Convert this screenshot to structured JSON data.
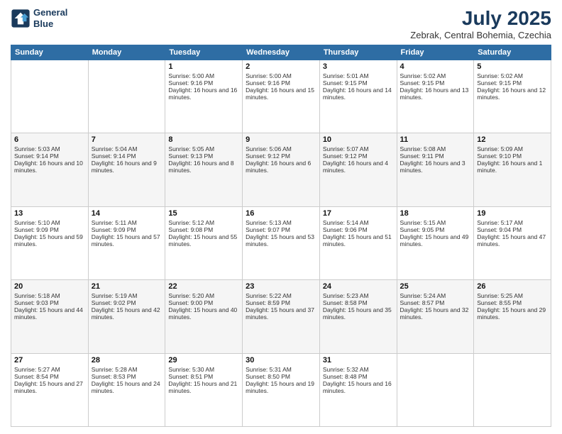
{
  "header": {
    "logo_line1": "General",
    "logo_line2": "Blue",
    "month": "July 2025",
    "location": "Zebrak, Central Bohemia, Czechia"
  },
  "days_of_week": [
    "Sunday",
    "Monday",
    "Tuesday",
    "Wednesday",
    "Thursday",
    "Friday",
    "Saturday"
  ],
  "weeks": [
    [
      {
        "day": "",
        "sunrise": "",
        "sunset": "",
        "daylight": ""
      },
      {
        "day": "",
        "sunrise": "",
        "sunset": "",
        "daylight": ""
      },
      {
        "day": "1",
        "sunrise": "Sunrise: 5:00 AM",
        "sunset": "Sunset: 9:16 PM",
        "daylight": "Daylight: 16 hours and 16 minutes."
      },
      {
        "day": "2",
        "sunrise": "Sunrise: 5:00 AM",
        "sunset": "Sunset: 9:16 PM",
        "daylight": "Daylight: 16 hours and 15 minutes."
      },
      {
        "day": "3",
        "sunrise": "Sunrise: 5:01 AM",
        "sunset": "Sunset: 9:15 PM",
        "daylight": "Daylight: 16 hours and 14 minutes."
      },
      {
        "day": "4",
        "sunrise": "Sunrise: 5:02 AM",
        "sunset": "Sunset: 9:15 PM",
        "daylight": "Daylight: 16 hours and 13 minutes."
      },
      {
        "day": "5",
        "sunrise": "Sunrise: 5:02 AM",
        "sunset": "Sunset: 9:15 PM",
        "daylight": "Daylight: 16 hours and 12 minutes."
      }
    ],
    [
      {
        "day": "6",
        "sunrise": "Sunrise: 5:03 AM",
        "sunset": "Sunset: 9:14 PM",
        "daylight": "Daylight: 16 hours and 10 minutes."
      },
      {
        "day": "7",
        "sunrise": "Sunrise: 5:04 AM",
        "sunset": "Sunset: 9:14 PM",
        "daylight": "Daylight: 16 hours and 9 minutes."
      },
      {
        "day": "8",
        "sunrise": "Sunrise: 5:05 AM",
        "sunset": "Sunset: 9:13 PM",
        "daylight": "Daylight: 16 hours and 8 minutes."
      },
      {
        "day": "9",
        "sunrise": "Sunrise: 5:06 AM",
        "sunset": "Sunset: 9:12 PM",
        "daylight": "Daylight: 16 hours and 6 minutes."
      },
      {
        "day": "10",
        "sunrise": "Sunrise: 5:07 AM",
        "sunset": "Sunset: 9:12 PM",
        "daylight": "Daylight: 16 hours and 4 minutes."
      },
      {
        "day": "11",
        "sunrise": "Sunrise: 5:08 AM",
        "sunset": "Sunset: 9:11 PM",
        "daylight": "Daylight: 16 hours and 3 minutes."
      },
      {
        "day": "12",
        "sunrise": "Sunrise: 5:09 AM",
        "sunset": "Sunset: 9:10 PM",
        "daylight": "Daylight: 16 hours and 1 minute."
      }
    ],
    [
      {
        "day": "13",
        "sunrise": "Sunrise: 5:10 AM",
        "sunset": "Sunset: 9:09 PM",
        "daylight": "Daylight: 15 hours and 59 minutes."
      },
      {
        "day": "14",
        "sunrise": "Sunrise: 5:11 AM",
        "sunset": "Sunset: 9:09 PM",
        "daylight": "Daylight: 15 hours and 57 minutes."
      },
      {
        "day": "15",
        "sunrise": "Sunrise: 5:12 AM",
        "sunset": "Sunset: 9:08 PM",
        "daylight": "Daylight: 15 hours and 55 minutes."
      },
      {
        "day": "16",
        "sunrise": "Sunrise: 5:13 AM",
        "sunset": "Sunset: 9:07 PM",
        "daylight": "Daylight: 15 hours and 53 minutes."
      },
      {
        "day": "17",
        "sunrise": "Sunrise: 5:14 AM",
        "sunset": "Sunset: 9:06 PM",
        "daylight": "Daylight: 15 hours and 51 minutes."
      },
      {
        "day": "18",
        "sunrise": "Sunrise: 5:15 AM",
        "sunset": "Sunset: 9:05 PM",
        "daylight": "Daylight: 15 hours and 49 minutes."
      },
      {
        "day": "19",
        "sunrise": "Sunrise: 5:17 AM",
        "sunset": "Sunset: 9:04 PM",
        "daylight": "Daylight: 15 hours and 47 minutes."
      }
    ],
    [
      {
        "day": "20",
        "sunrise": "Sunrise: 5:18 AM",
        "sunset": "Sunset: 9:03 PM",
        "daylight": "Daylight: 15 hours and 44 minutes."
      },
      {
        "day": "21",
        "sunrise": "Sunrise: 5:19 AM",
        "sunset": "Sunset: 9:02 PM",
        "daylight": "Daylight: 15 hours and 42 minutes."
      },
      {
        "day": "22",
        "sunrise": "Sunrise: 5:20 AM",
        "sunset": "Sunset: 9:00 PM",
        "daylight": "Daylight: 15 hours and 40 minutes."
      },
      {
        "day": "23",
        "sunrise": "Sunrise: 5:22 AM",
        "sunset": "Sunset: 8:59 PM",
        "daylight": "Daylight: 15 hours and 37 minutes."
      },
      {
        "day": "24",
        "sunrise": "Sunrise: 5:23 AM",
        "sunset": "Sunset: 8:58 PM",
        "daylight": "Daylight: 15 hours and 35 minutes."
      },
      {
        "day": "25",
        "sunrise": "Sunrise: 5:24 AM",
        "sunset": "Sunset: 8:57 PM",
        "daylight": "Daylight: 15 hours and 32 minutes."
      },
      {
        "day": "26",
        "sunrise": "Sunrise: 5:25 AM",
        "sunset": "Sunset: 8:55 PM",
        "daylight": "Daylight: 15 hours and 29 minutes."
      }
    ],
    [
      {
        "day": "27",
        "sunrise": "Sunrise: 5:27 AM",
        "sunset": "Sunset: 8:54 PM",
        "daylight": "Daylight: 15 hours and 27 minutes."
      },
      {
        "day": "28",
        "sunrise": "Sunrise: 5:28 AM",
        "sunset": "Sunset: 8:53 PM",
        "daylight": "Daylight: 15 hours and 24 minutes."
      },
      {
        "day": "29",
        "sunrise": "Sunrise: 5:30 AM",
        "sunset": "Sunset: 8:51 PM",
        "daylight": "Daylight: 15 hours and 21 minutes."
      },
      {
        "day": "30",
        "sunrise": "Sunrise: 5:31 AM",
        "sunset": "Sunset: 8:50 PM",
        "daylight": "Daylight: 15 hours and 19 minutes."
      },
      {
        "day": "31",
        "sunrise": "Sunrise: 5:32 AM",
        "sunset": "Sunset: 8:48 PM",
        "daylight": "Daylight: 15 hours and 16 minutes."
      },
      {
        "day": "",
        "sunrise": "",
        "sunset": "",
        "daylight": ""
      },
      {
        "day": "",
        "sunrise": "",
        "sunset": "",
        "daylight": ""
      }
    ]
  ]
}
